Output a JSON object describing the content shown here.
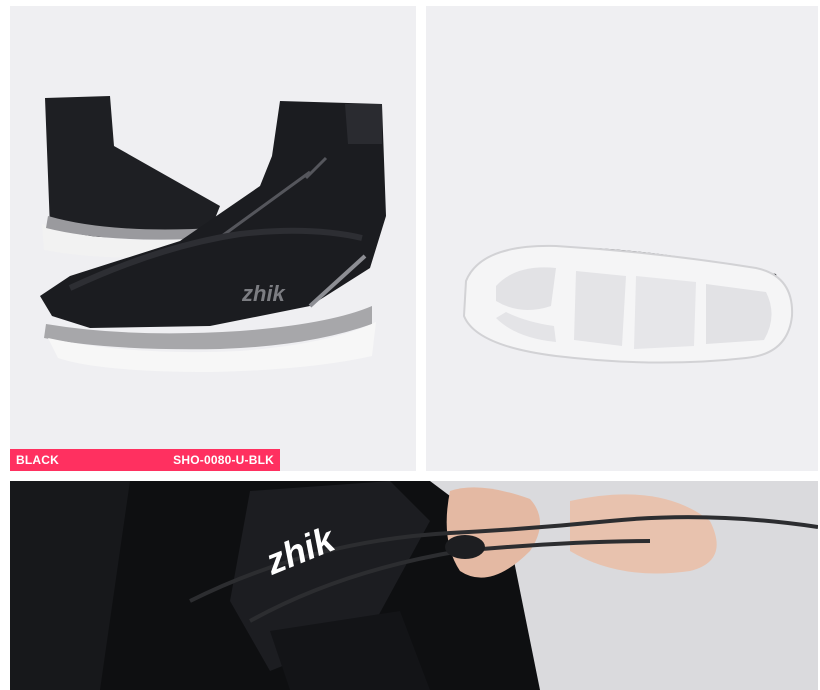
{
  "product": {
    "colour_name": "BLACK",
    "sku": "SHO-0080-U-BLK",
    "badge_color": "#ff3060"
  },
  "images": {
    "boots": {
      "brand_mark": "zhik"
    },
    "sole": {},
    "detail": {
      "brand_mark": "zhik"
    }
  }
}
